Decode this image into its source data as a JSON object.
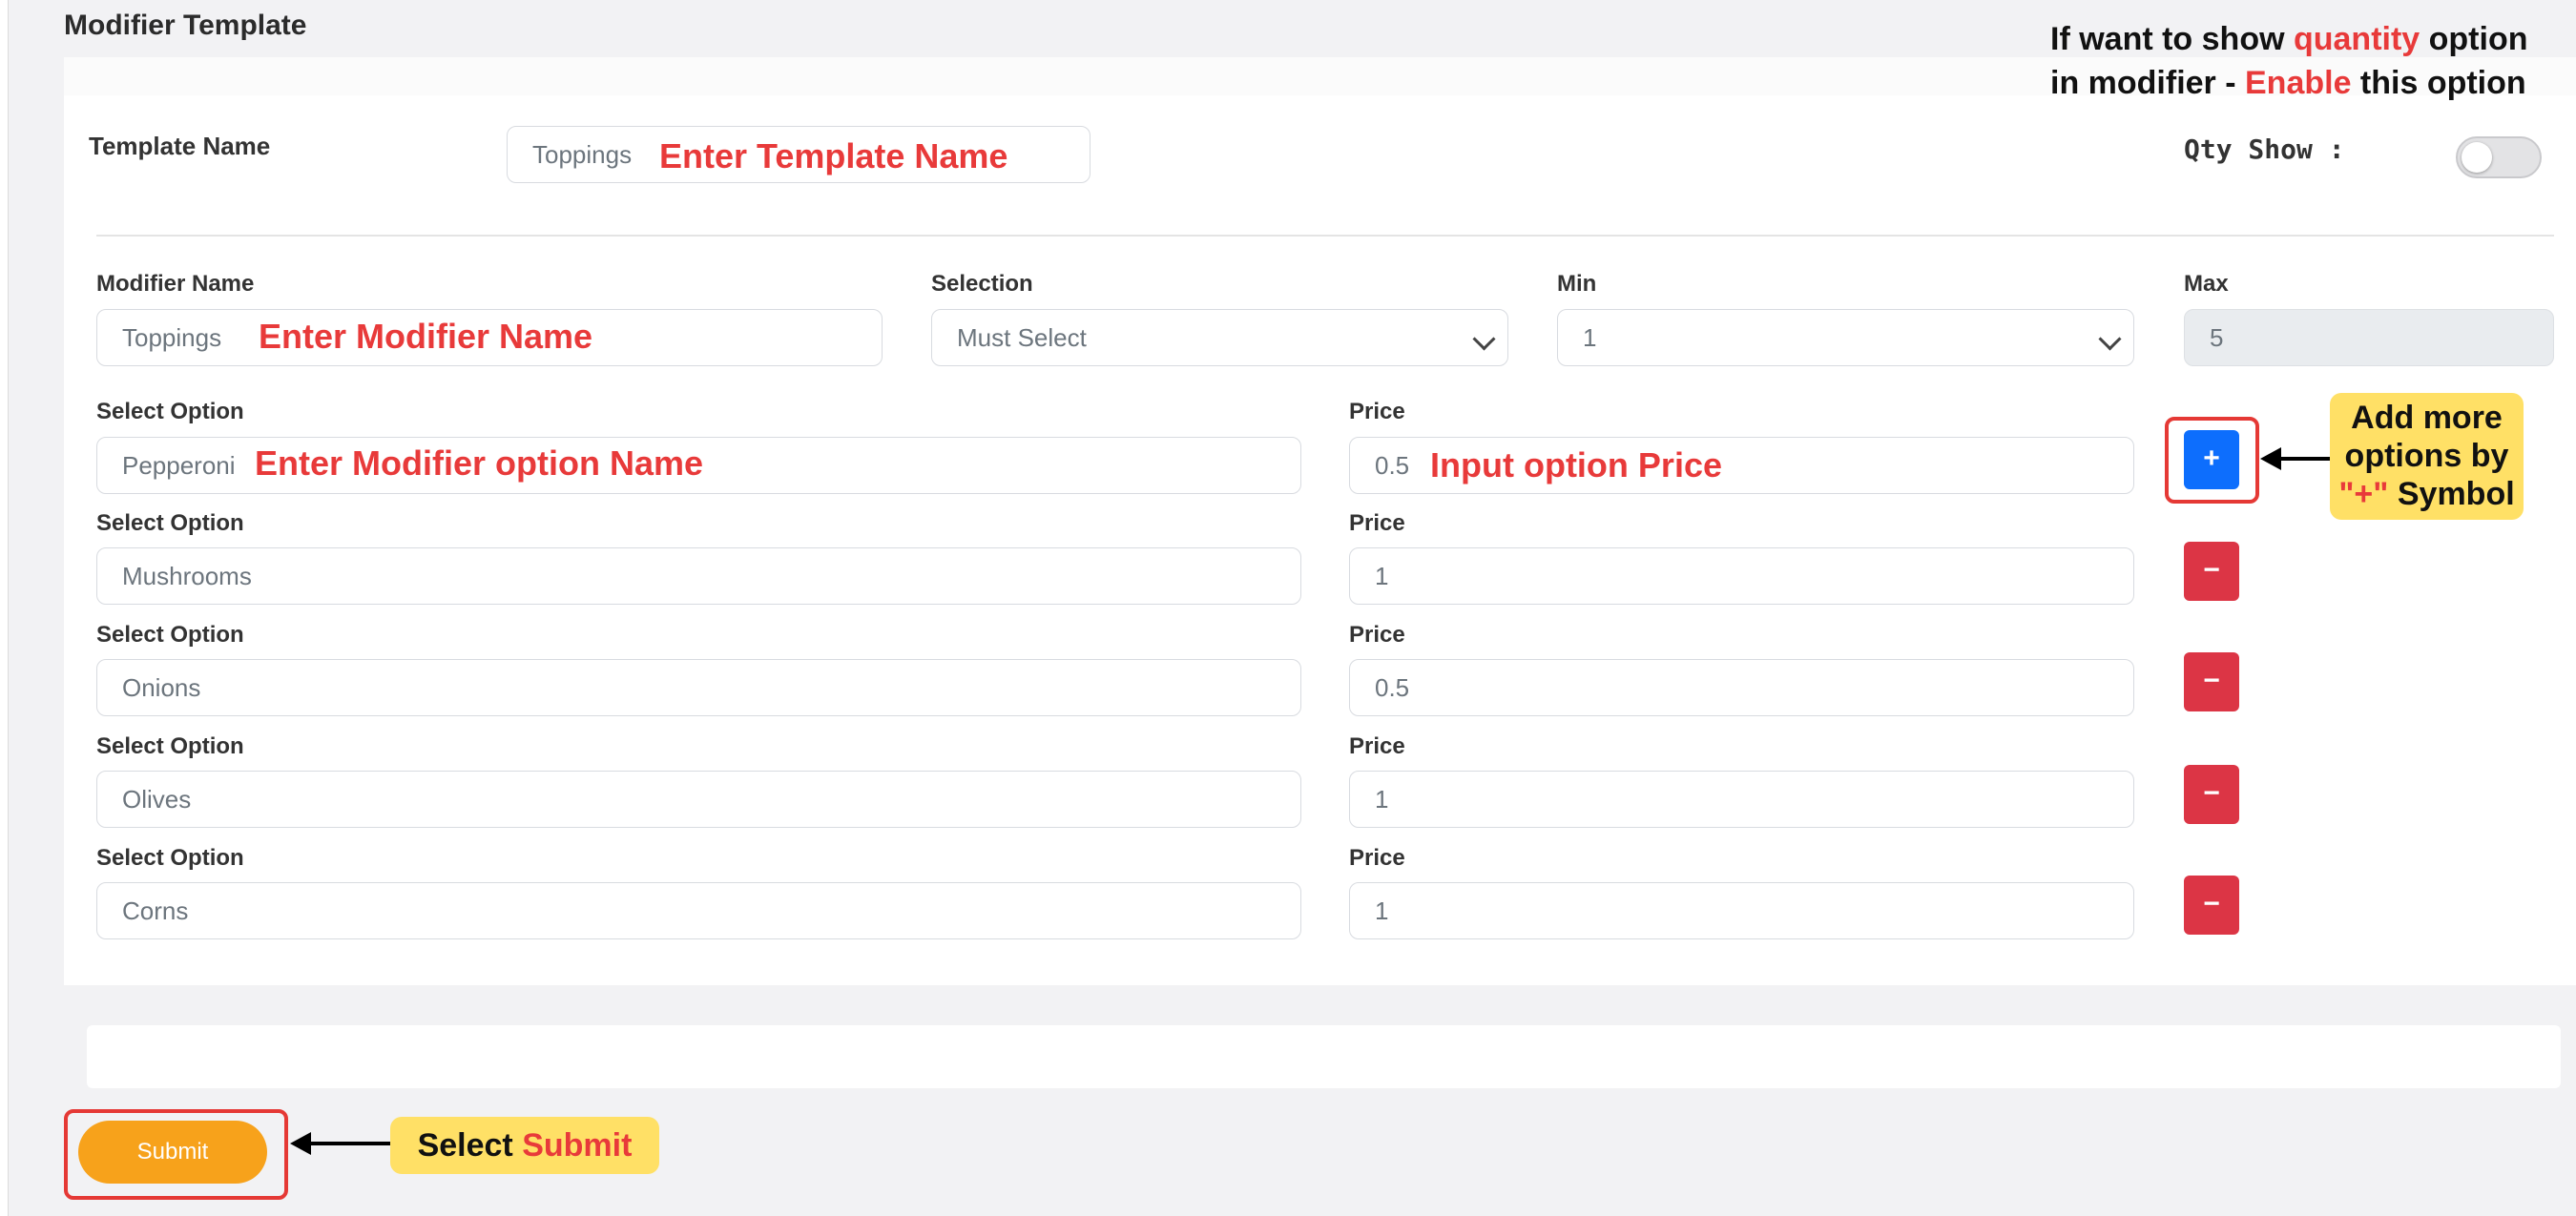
{
  "page_title": "Modifier Template",
  "top_note": {
    "line1_prefix": "If want to show ",
    "line1_highlight": "quantity",
    "line1_suffix": " option",
    "line2_prefix": "in modifier - ",
    "line2_highlight": "Enable",
    "line2_suffix": " this option"
  },
  "template": {
    "label": "Template Name",
    "value": "Toppings",
    "annotation": "Enter Template Name"
  },
  "qty_show": {
    "label": "Qty Show :",
    "enabled": false
  },
  "modifier": {
    "name_label": "Modifier Name",
    "name_value": "Toppings",
    "name_annotation": "Enter Modifier Name",
    "selection_label": "Selection",
    "selection_value": "Must Select",
    "min_label": "Min",
    "min_value": "1",
    "max_label": "Max",
    "max_value": "5"
  },
  "options": [
    {
      "label": "Select Option",
      "value": "Pepperoni",
      "price_label": "Price",
      "price": "0.5",
      "action": "+"
    },
    {
      "label": "Select Option",
      "value": "Mushrooms",
      "price_label": "Price",
      "price": "1",
      "action": "−"
    },
    {
      "label": "Select Option",
      "value": "Onions",
      "price_label": "Price",
      "price": "0.5",
      "action": "−"
    },
    {
      "label": "Select Option",
      "value": "Olives",
      "price_label": "Price",
      "price": "1",
      "action": "−"
    },
    {
      "label": "Select Option",
      "value": "Corns",
      "price_label": "Price",
      "price": "1",
      "action": "−"
    }
  ],
  "annotations": {
    "option_name": "Enter Modifier option  Name",
    "option_price": "Input option Price",
    "add_more": {
      "line1": "Add more",
      "line2": "options by",
      "symbol": "\"+\"",
      "line3_suffix": " Symbol"
    },
    "submit": {
      "prefix": "Select ",
      "highlight": "Submit"
    }
  },
  "submit_label": "Submit",
  "colors": {
    "primary": "#0d6efd",
    "danger": "#dc3545",
    "submit": "#f7a21b",
    "annotation_red": "#e83a3a",
    "callout_yellow": "#ffe066"
  }
}
